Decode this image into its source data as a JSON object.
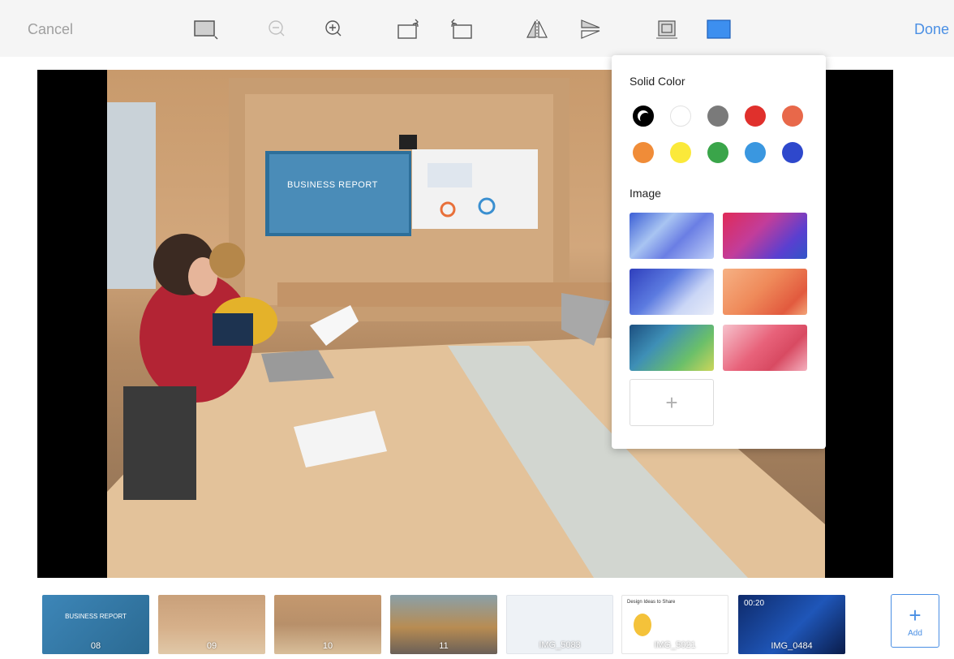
{
  "toolbar": {
    "cancel_label": "Cancel",
    "done_label": "Done",
    "accent_color": "#4a8fe4",
    "icons": [
      "background-rectangle-icon",
      "zoom-out-icon",
      "zoom-in-icon",
      "rotate-left-icon",
      "rotate-right-icon",
      "flip-horizontal-icon",
      "flip-vertical-icon",
      "crop-icon",
      "background-fill-icon"
    ]
  },
  "background_panel": {
    "solid_color_title": "Solid Color",
    "colors": [
      "#000000",
      "#ffffff",
      "#7a7a7a",
      "#e0302c",
      "#e8684a",
      "#f08c38",
      "#fbe93a",
      "#3aa54a",
      "#3a97e0",
      "#2e48cc"
    ],
    "selected_color": "#000000",
    "image_title": "Image",
    "image_count": 6,
    "add_image_symbol": "+"
  },
  "slide": {
    "screen_title": "BUSINESS REPORT"
  },
  "filmstrip": {
    "thumbnails": [
      {
        "label": "08",
        "title": "BUSINESS REPORT"
      },
      {
        "label": "09"
      },
      {
        "label": "10"
      },
      {
        "label": "11"
      },
      {
        "label": "IMG_5083"
      },
      {
        "label": "IMG_5021",
        "title": "Design Ideas to Share"
      },
      {
        "label": "IMG_0484",
        "time": "00:20"
      }
    ],
    "add_symbol": "+",
    "add_label": "Add"
  }
}
